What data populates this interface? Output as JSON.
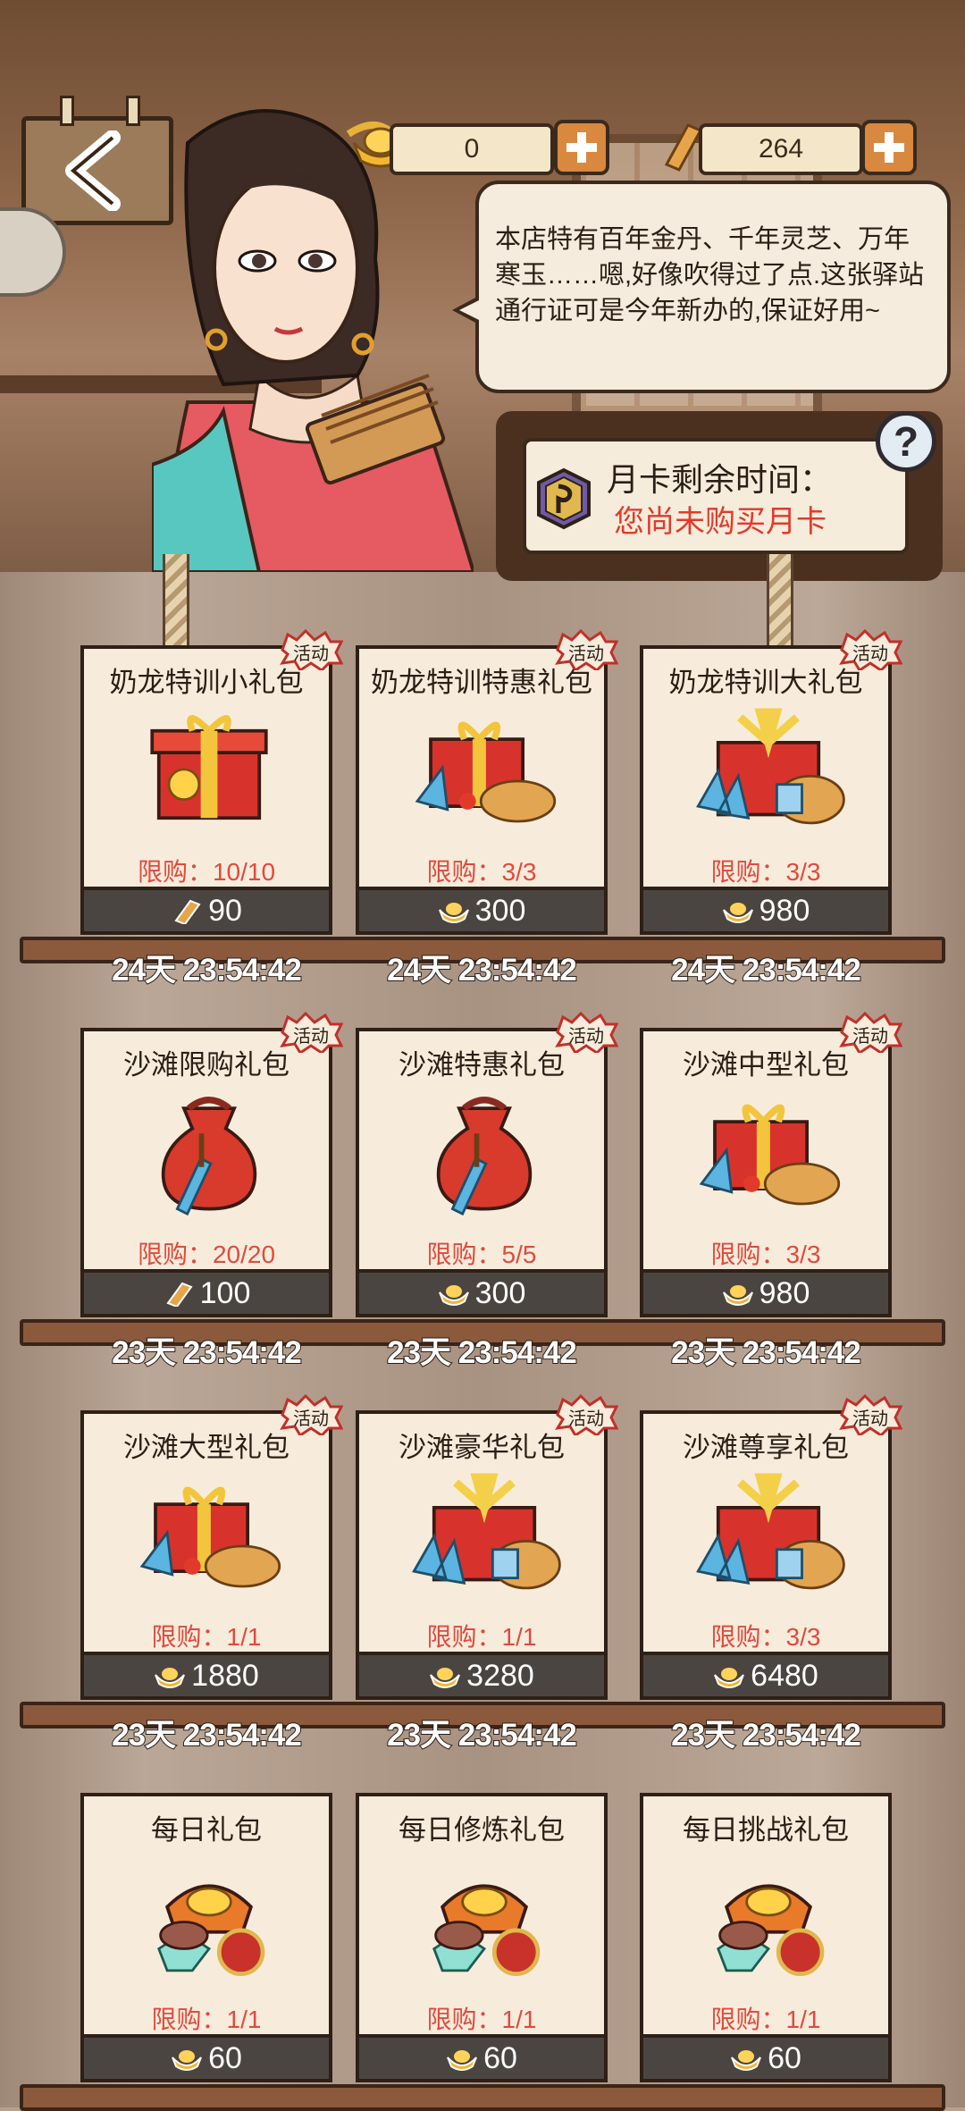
{
  "currencies": {
    "gold_ingot_value": "0",
    "silver_bar_value": "264"
  },
  "speech": {
    "text": "本店特有百年金丹、千年灵芝、万年寒玉……嗯,好像吹得过了点.这张驿站通行证可是今年新办的,保证好用~"
  },
  "month_card": {
    "label": "月卡剩余时间：",
    "status": "您尚未购买月卡",
    "help": "?"
  },
  "badge_text": "活动",
  "packs": [
    {
      "name": "奶龙特训小礼包",
      "limit": "限购：10/10",
      "price": "90",
      "currency": "bar",
      "art": "gift",
      "badge": true,
      "timer": "24天 23:54:42"
    },
    {
      "name": "奶龙特训特惠礼包",
      "limit": "限购：3/3",
      "price": "300",
      "currency": "ingot",
      "art": "gift-gold",
      "badge": true,
      "timer": "24天 23:54:42"
    },
    {
      "name": "奶龙特训大礼包",
      "limit": "限购：3/3",
      "price": "980",
      "currency": "ingot",
      "art": "gift-big",
      "badge": true,
      "timer": "24天 23:54:42"
    },
    {
      "name": "沙滩限购礼包",
      "limit": "限购：20/20",
      "price": "100",
      "currency": "bar",
      "art": "bag",
      "badge": true,
      "timer": "23天 23:54:42"
    },
    {
      "name": "沙滩特惠礼包",
      "limit": "限购：5/5",
      "price": "300",
      "currency": "ingot",
      "art": "bag",
      "badge": true,
      "timer": "23天 23:54:42"
    },
    {
      "name": "沙滩中型礼包",
      "limit": "限购：3/3",
      "price": "980",
      "currency": "ingot",
      "art": "gift-gold",
      "badge": true,
      "timer": "23天 23:54:42"
    },
    {
      "name": "沙滩大型礼包",
      "limit": "限购：1/1",
      "price": "1880",
      "currency": "ingot",
      "art": "gift-gold",
      "badge": true,
      "timer": "23天 23:54:42"
    },
    {
      "name": "沙滩豪华礼包",
      "limit": "限购：1/1",
      "price": "3280",
      "currency": "ingot",
      "art": "gift-big",
      "badge": true,
      "timer": "23天 23:54:42"
    },
    {
      "name": "沙滩尊享礼包",
      "limit": "限购：3/3",
      "price": "6480",
      "currency": "ingot",
      "art": "gift-big",
      "badge": true,
      "timer": "23天 23:54:42"
    },
    {
      "name": "每日礼包",
      "limit": "限购：1/1",
      "price": "60",
      "currency": "ingot",
      "art": "daily",
      "badge": false,
      "timer": ""
    },
    {
      "name": "每日修炼礼包",
      "limit": "限购：1/1",
      "price": "60",
      "currency": "ingot",
      "art": "daily",
      "badge": false,
      "timer": ""
    },
    {
      "name": "每日挑战礼包",
      "limit": "限购：1/1",
      "price": "60",
      "currency": "ingot",
      "art": "daily",
      "badge": false,
      "timer": ""
    }
  ],
  "colors": {
    "limit_red": "#e24a3c",
    "price_bar": "#4b4542",
    "card_bg": "#f7ecdc",
    "shelf_wood": "#8b5a3c"
  }
}
